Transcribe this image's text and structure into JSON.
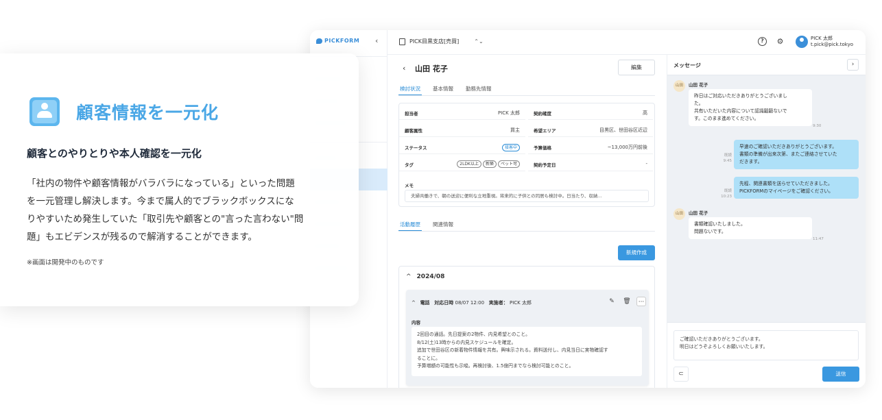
{
  "app": {
    "logo": "PICKFORM",
    "store": "PICK目黒支店[売買]",
    "user_name": "PICK 太郎",
    "user_email": "t.pick@pick.tokyo"
  },
  "customer": {
    "name": "山田 花子",
    "edit_label": "編集",
    "tabs": [
      "検討状況",
      "基本情報",
      "勤務先情報"
    ],
    "fields": {
      "staff_label": "担当者",
      "staff_value": "PICK 太郎",
      "level_label": "契約確度",
      "level_value": "高",
      "attr_label": "顧客属性",
      "attr_value": "買主",
      "area_label": "希望エリア",
      "area_value": "目黒区、世田谷区近辺",
      "status_label": "ステータス",
      "status_value": "接客中",
      "budget_label": "予算価格",
      "budget_value": "~13,000万円前後",
      "tag_label": "タグ",
      "tags": [
        "2LDK以上",
        "新築",
        "ペット可"
      ],
      "date_label": "契約予定日",
      "date_value": "-"
    },
    "memo_label": "メモ",
    "memo": "夫婦共働きで、朝の送迎に便利な立地重視。将来的に子供との同居も検討中。日当たり、収納..."
  },
  "activity": {
    "tabs": [
      "活動履歴",
      "関連情報"
    ],
    "new_label": "新規作成",
    "month": "2024/08",
    "entry": {
      "type": "電話",
      "date_label": "対応日時",
      "date": "08/07 12:00",
      "person_label": "実施者：",
      "person": "PICK 太郎",
      "content_label": "内容",
      "lines": [
        "2回目の通話。先日提案の2物件、内見希望とのこと。",
        "8/12(土)13時からの内見スケジュールを確定。",
        "追加で世田谷区の新着物件情報を共有。興味示される。資料送付し、内見当日に実物確認す",
        "ることに。",
        "予算増額の可能性も示唆。再検討後、1.5億円までなら検討可能とのこと。"
      ]
    }
  },
  "messages": {
    "title": "メッセージ",
    "items": [
      {
        "sender": "山田 花子",
        "avatar": "山田",
        "lines": [
          "昨日はご対応いただきありがとうございまし",
          "た。",
          "共有いただいた内容について認識齟齬ないで",
          "す。このまま進めてください。"
        ],
        "time": "9:30"
      },
      {
        "status": "既読",
        "lines": [
          "早速のご確認いただきありがとうございます。",
          "書類の準備が出来次第、またご連絡させていた",
          "だきます。"
        ],
        "time": "9:45"
      },
      {
        "status": "既読",
        "lines": [
          "先程、関連書類を送らせていただきました。",
          "PICKFORMのマイページをご確認ください。"
        ],
        "time": "10:23"
      },
      {
        "sender": "山田 花子",
        "avatar": "山田",
        "lines": [
          "書類確認いたしました。",
          "問題ないです。"
        ],
        "time": "11:47"
      }
    ],
    "draft": [
      "ご確認いただきありがとうございます。",
      "明日はどうぞよろしくお願いいたします。"
    ],
    "send_label": "送信"
  },
  "feature": {
    "title": "顧客情報を一元化",
    "subtitle": "顧客とのやりとりや本人確認を一元化",
    "body_lines": [
      "「社内の物件や顧客情報がバラバラになっている」といった問題",
      "を一元管理し解決します。今まで属人的でブラックボックスにな",
      "りやすいため発生していた「取引先や顧客との\"言った言わない\"問",
      "題」もエビデンスが残るので解消することができます。"
    ],
    "note": "※画面は開発中のものです"
  }
}
